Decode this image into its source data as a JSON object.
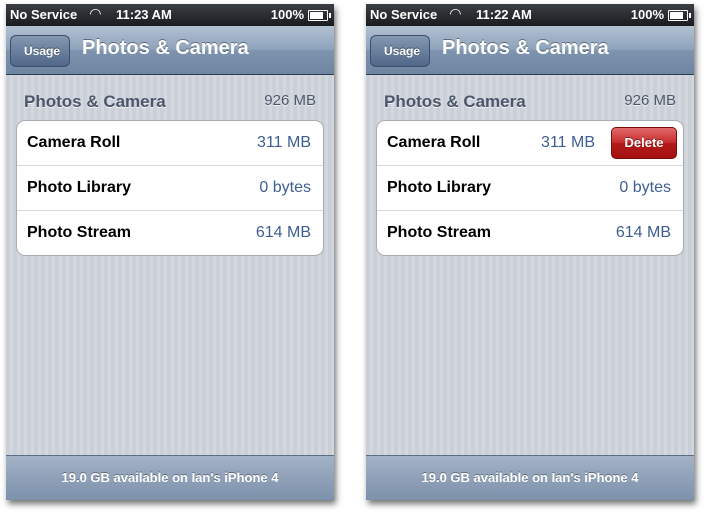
{
  "colors": {
    "nav_bar": "#7d93ae",
    "value_text": "#3e5e92",
    "delete_button": "#c62a2a",
    "background": "#cdd2da"
  },
  "screens": [
    {
      "status_bar": {
        "carrier": "No Service",
        "wifi_icon": "wifi-icon",
        "time": "11:23 AM",
        "battery": "100%"
      },
      "nav": {
        "back_label": "Usage",
        "title": "Photos & Camera"
      },
      "section": {
        "title": "Photos & Camera",
        "total": "926 MB"
      },
      "rows": [
        {
          "label": "Camera Roll",
          "size": "311 MB"
        },
        {
          "label": "Photo Library",
          "size": "0 bytes"
        },
        {
          "label": "Photo Stream",
          "size": "614 MB"
        }
      ],
      "footer": "19.0 GB available on Ian's iPhone 4"
    },
    {
      "status_bar": {
        "carrier": "No Service",
        "wifi_icon": "wifi-icon",
        "time": "11:22 AM",
        "battery": "100%"
      },
      "nav": {
        "back_label": "Usage",
        "title": "Photos & Camera"
      },
      "section": {
        "title": "Photos & Camera",
        "total": "926 MB"
      },
      "rows": [
        {
          "label": "Camera Roll",
          "size": "311 MB",
          "delete_label": "Delete"
        },
        {
          "label": "Photo Library",
          "size": "0 bytes"
        },
        {
          "label": "Photo Stream",
          "size": "614 MB"
        }
      ],
      "footer": "19.0 GB available on Ian's iPhone 4"
    }
  ]
}
